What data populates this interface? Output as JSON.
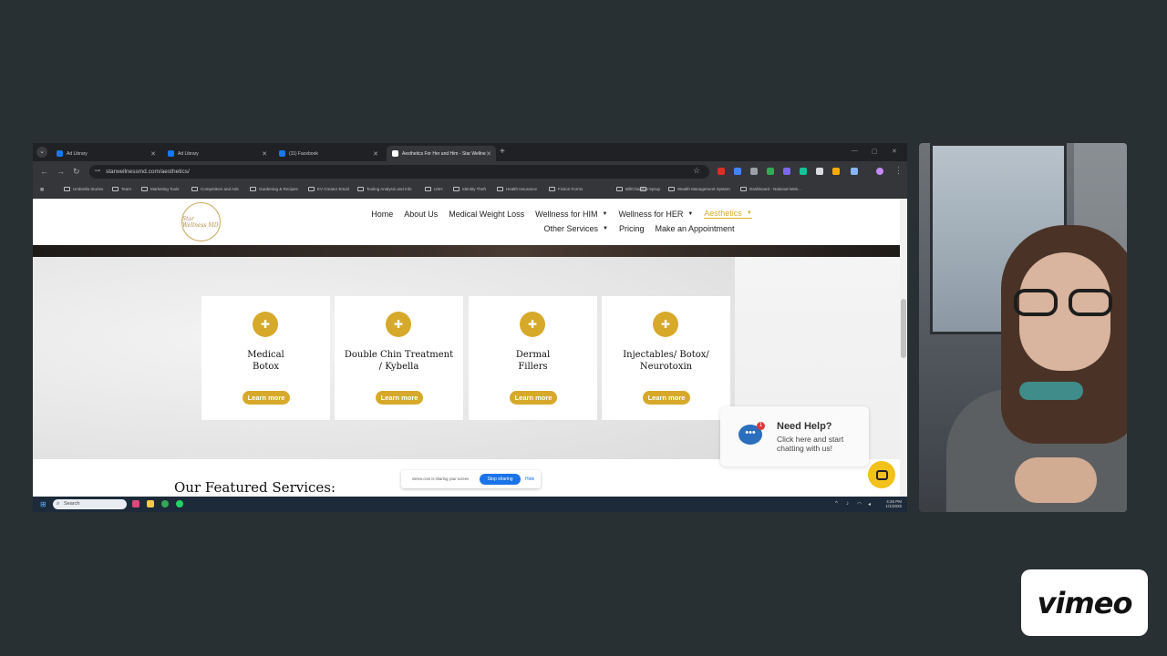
{
  "browser": {
    "tabs": [
      {
        "label": "Ad Library",
        "color": "#1877f2",
        "active": false
      },
      {
        "label": "Ad Library",
        "color": "#1877f2",
        "active": false
      },
      {
        "label": "(11) Facebook",
        "color": "#1877f2",
        "active": false
      },
      {
        "label": "Aesthetics For Her and Him - Star Wellness",
        "color": "#ffffff",
        "active": true
      }
    ],
    "url": "starwellnessmd.com/aesthetics/",
    "bookmarks": [
      "Umbrella Stories",
      "Team",
      "Marketing Tools",
      "Competitors and Ads",
      "Gardening & Recipes",
      "EV Creator Email",
      "Tooling Analysis and Info",
      "USH",
      "Identity Theft",
      "Health Insurance",
      "Fiction Forms",
      "Bill/Chamber",
      "Sprup",
      "Wealth Management System",
      "Dashboard - National Web..."
    ]
  },
  "site": {
    "logo_text": "Star Wellness MD",
    "nav_row1": [
      {
        "label": "Home",
        "caret": false,
        "active": false
      },
      {
        "label": "About Us",
        "caret": false,
        "active": false
      },
      {
        "label": "Medical Weight Loss",
        "caret": false,
        "active": false
      },
      {
        "label": "Wellness for HIM",
        "caret": true,
        "active": false
      },
      {
        "label": "Wellness for HER",
        "caret": true,
        "active": false
      },
      {
        "label": "Aesthetics",
        "caret": true,
        "active": true
      }
    ],
    "nav_row2": [
      {
        "label": "Other Services",
        "caret": true,
        "active": false
      },
      {
        "label": "Pricing",
        "caret": false,
        "active": false
      },
      {
        "label": "Make an Appointment",
        "caret": false,
        "active": false
      }
    ],
    "cards": [
      {
        "title": "Medical\nBotox",
        "button": "Learn more"
      },
      {
        "title": "Double Chin Treatment\n/ Kybella",
        "button": "Learn more"
      },
      {
        "title": "Dermal\nFillers",
        "button": "Learn more"
      },
      {
        "title": "Injectables/ Botox/\nNeurotoxin",
        "button": "Learn more"
      }
    ],
    "featured_heading": "Our Featured Services:",
    "help_widget": {
      "heading": "Need Help?",
      "subtext": "Click here and start chatting with us!",
      "badge": "1"
    }
  },
  "sharebar": {
    "text": "vimeo.com is sharing your screen",
    "stop_label": "Stop sharing",
    "hide_label": "Hide"
  },
  "taskbar": {
    "search_placeholder": "Search",
    "time": "4:26 PM",
    "date": "1/1/2025"
  },
  "brand": {
    "vimeo_logo": "vimeo"
  },
  "colors": {
    "accent_gold": "#d7a92b",
    "background": "#283034"
  }
}
